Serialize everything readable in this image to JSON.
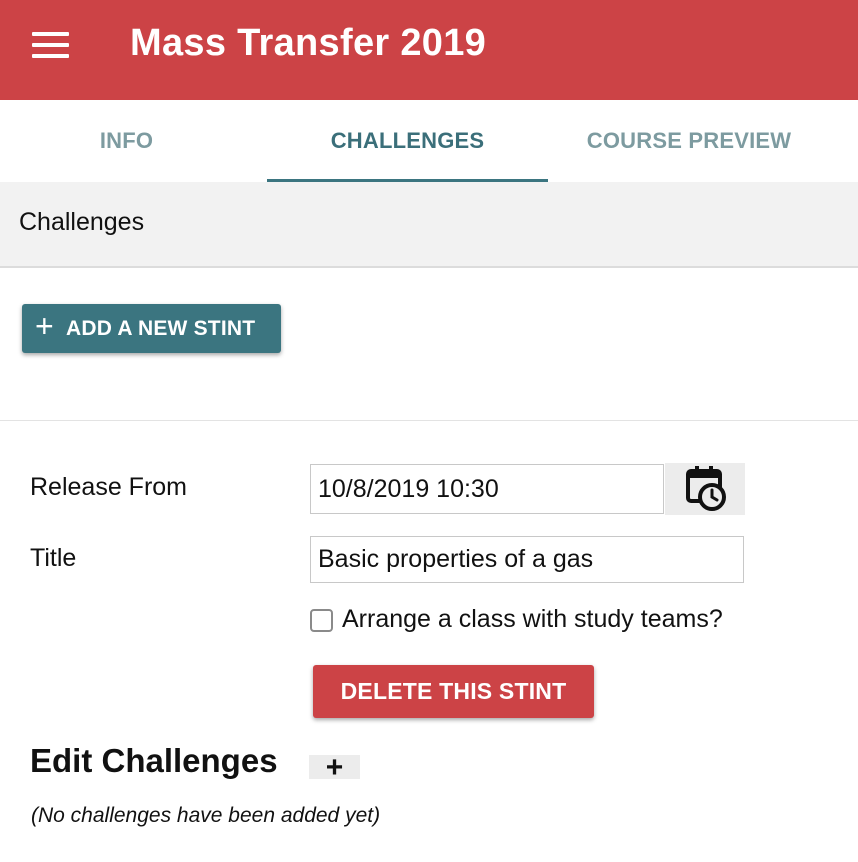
{
  "app": {
    "title": "Mass Transfer 2019",
    "menu_icon": "hamburger-menu-icon",
    "accent_color": "#cc4346",
    "primary_color": "#3b7580"
  },
  "tabs": [
    {
      "label": "INFO",
      "active": false
    },
    {
      "label": "CHALLENGES",
      "active": true
    },
    {
      "label": "COURSE PREVIEW",
      "active": false
    }
  ],
  "section": {
    "title": "Challenges"
  },
  "add_stint_button": {
    "icon": "plus-icon",
    "label": "ADD A NEW STINT"
  },
  "stint": {
    "release_from_label": "Release From",
    "release_from_value": "10/8/2019 10:30",
    "calendar_icon": "calendar-clock-icon",
    "title_label": "Title",
    "title_value": "Basic properties of a gas",
    "study_teams_label": "Arrange a class with study teams?",
    "study_teams_checked": false,
    "delete_label": "DELETE THIS STINT"
  },
  "edit_challenges": {
    "heading": "Edit Challenges",
    "add_icon": "plus-icon",
    "add_label": "+",
    "empty_message": "(No challenges have been added yet)"
  }
}
